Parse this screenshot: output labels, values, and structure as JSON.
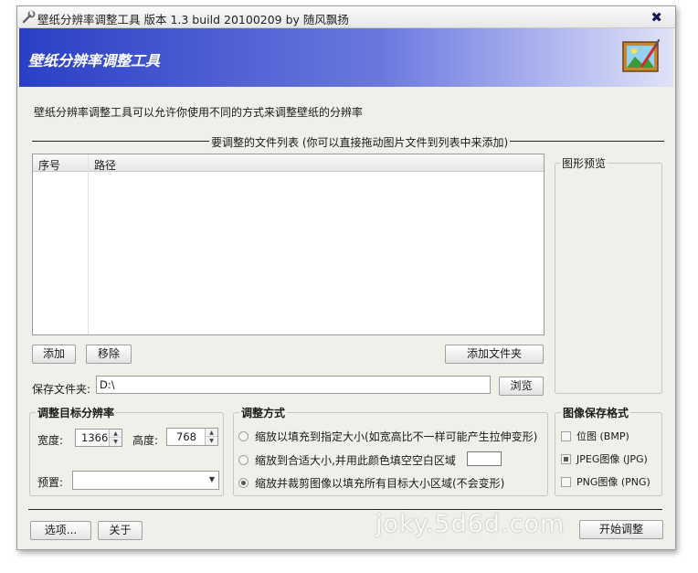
{
  "window": {
    "title": "壁纸分辨率调整工具 版本 1.3 build 20100209 by 随风飘扬",
    "close_glyph": "✖"
  },
  "banner": {
    "title": "壁纸分辨率调整工具",
    "gradient_start": "#2a3fc4",
    "icon": "paint-picture-icon"
  },
  "description": "壁纸分辨率调整工具可以允许你使用不同的方式来调整壁纸的分辨率",
  "file_list": {
    "section_label": "要调整的文件列表 (你可以直接拖动图片文件到列表中来添加)",
    "columns": [
      "序号",
      "路径"
    ],
    "rows": [],
    "add_button": "添加",
    "remove_button": "移除",
    "add_folder_button": "添加文件夹"
  },
  "preview": {
    "label": "图形预览"
  },
  "save_folder": {
    "label": "保存文件夹:",
    "value": "D:\\",
    "browse_button": "浏览"
  },
  "target_resolution": {
    "group_label": "调整目标分辨率",
    "width_label": "宽度:",
    "width_value": "1366",
    "height_label": "高度:",
    "height_value": "768",
    "preset_label": "预置:",
    "preset_value": ""
  },
  "adjust_mode": {
    "group_label": "调整方式",
    "options": [
      {
        "label": "缩放以填充到指定大小(如宽高比不一样可能产生拉伸变形)",
        "selected": false
      },
      {
        "label": "缩放到合适大小,并用此颜色填空空白区域",
        "selected": false
      },
      {
        "label": "缩放并裁剪图像以填充所有目标大小区域(不会变形)",
        "selected": true
      }
    ],
    "fill_color": "#ffffff"
  },
  "save_format": {
    "group_label": "图像保存格式",
    "options": [
      {
        "label": "位图 (BMP)",
        "checked": false
      },
      {
        "label": "JPEG图像 (JPG)",
        "checked": true
      },
      {
        "label": "PNG图像 (PNG)",
        "checked": false
      }
    ]
  },
  "footer": {
    "options_button": "选项...",
    "about_button": "关于",
    "start_button": "开始调整",
    "watermark": "joky.5d6d.com"
  }
}
